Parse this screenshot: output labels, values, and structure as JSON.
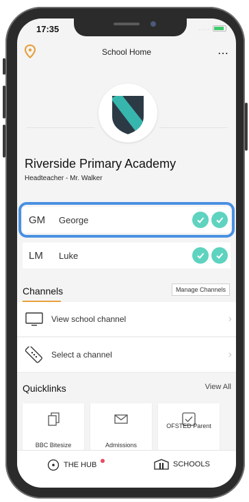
{
  "status_bar": {
    "time": "17:35",
    "signal": "....."
  },
  "header": {
    "title": "School Home",
    "more_icon": "⋯"
  },
  "school": {
    "name": "Riverside Primary Academy",
    "subtitle": "Headteacher - Mr. Walker"
  },
  "children": [
    {
      "initials": "GM",
      "name": "George"
    },
    {
      "initials": "LM",
      "name": "Luke"
    }
  ],
  "channels": {
    "title": "Channels",
    "manage_label": "Manage Channels",
    "items": [
      {
        "label": "View school channel",
        "icon": "tv-icon"
      },
      {
        "label": "Select a channel",
        "icon": "remote-icon"
      }
    ]
  },
  "quicklinks": {
    "title": "Quicklinks",
    "view_all": "View All",
    "items": [
      {
        "label": "BBC Bitesize",
        "icon": "document-stack-icon"
      },
      {
        "label": "Admissions",
        "icon": "envelope-icon"
      },
      {
        "label": "OFSTED Parent",
        "icon": "checkbox-icon"
      }
    ]
  },
  "tabs": {
    "hub": "THE HUB",
    "schools": "SCHOOLS"
  },
  "colors": {
    "accent": "#e8a03c",
    "check": "#5ed3bf",
    "highlight": "#4a90e2",
    "badge": "#e84a5f"
  }
}
